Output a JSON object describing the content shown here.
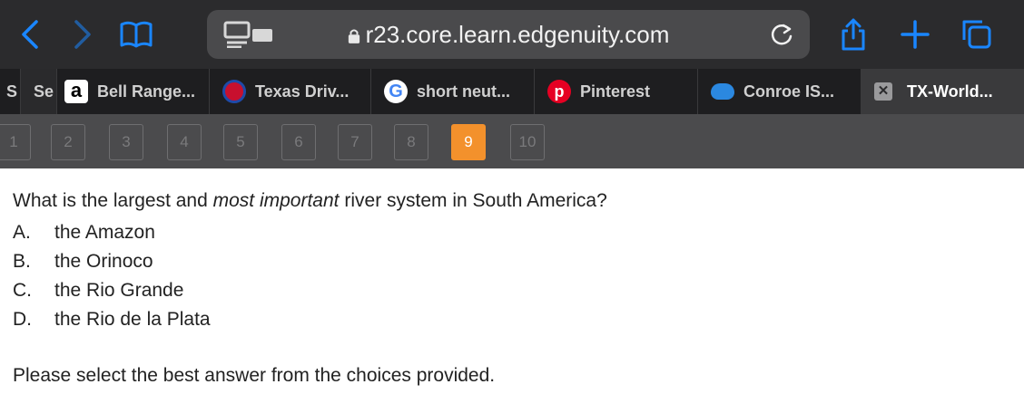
{
  "browser": {
    "url": "r23.core.learn.edgenuity.com",
    "toolbar_icons": [
      "back-icon",
      "forward-icon",
      "bookmarks-icon",
      "tab-overview-icon",
      "reload-icon",
      "share-icon",
      "new-tab-icon",
      "tabs-icon"
    ],
    "accent_color": "#1a86ff",
    "tabs": [
      {
        "label": "S",
        "icon": ""
      },
      {
        "label": "Se",
        "icon": ""
      },
      {
        "label": "Bell Range...",
        "icon": "amazon-icon"
      },
      {
        "label": "Texas Driv...",
        "icon": "texas-icon"
      },
      {
        "label": "short neut...",
        "icon": "google-icon"
      },
      {
        "label": "Pinterest",
        "icon": "pinterest-icon"
      },
      {
        "label": "Conroe IS...",
        "icon": "cloud-icon"
      },
      {
        "label": "TX-World...",
        "icon": "close-tab-icon"
      }
    ]
  },
  "question_nav": {
    "items": [
      "1",
      "2",
      "3",
      "4",
      "5",
      "6",
      "7",
      "8",
      "9",
      "10"
    ],
    "current": "9",
    "current_color": "#f3912c"
  },
  "quiz": {
    "question_before": "What is the largest and ",
    "question_emphasis": "most important",
    "question_after": " river system in South America?",
    "choices": [
      {
        "letter": "A.",
        "text": "the Amazon"
      },
      {
        "letter": "B.",
        "text": "the Orinoco"
      },
      {
        "letter": "C.",
        "text": "the Rio Grande"
      },
      {
        "letter": "D.",
        "text": "the Rio de la Plata"
      }
    ],
    "instruction": "Please select the best answer from the choices provided."
  }
}
